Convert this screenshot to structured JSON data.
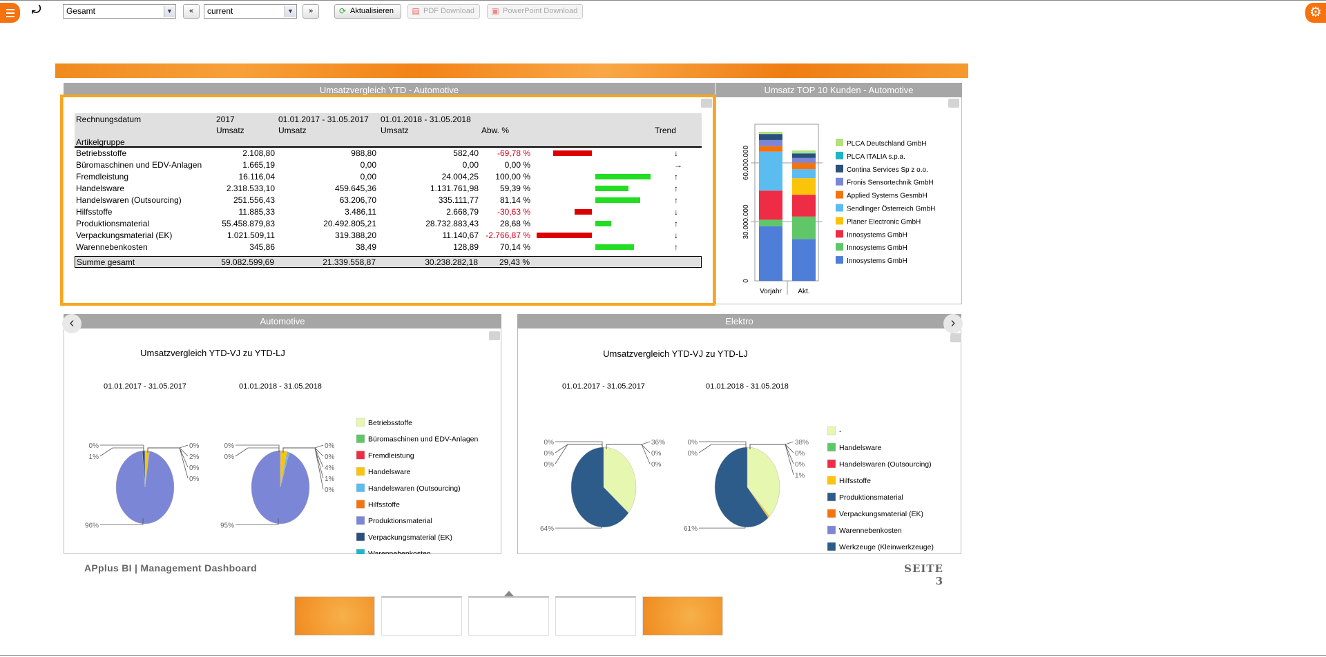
{
  "toolbar": {
    "menu_icon": "hamburger-icon",
    "return_icon": "return-arrow-icon",
    "scope_select": "Gesamt",
    "prev_label": "«",
    "period_select": "current",
    "next_label": "»",
    "refresh_label": "Aktualisieren",
    "pdf_label": "PDF Download",
    "ppt_label": "PowerPoint Download",
    "settings_icon": "gear-icon"
  },
  "colors": {
    "accent": "#f5730f",
    "highlight": "#f5a623",
    "header_gray": "#a6a6a6",
    "negative": "#d0021b",
    "positive_bar": "#22dd22",
    "negative_bar": "#dd0000"
  },
  "table_panel": {
    "title": "Umsatzvergleich YTD - Automotive",
    "header": {
      "rechnungsdatum": "Rechnungsdatum",
      "artikelgruppe": "Artikelgruppe",
      "col1_period": "2017",
      "col2_period": "01.01.2017 - 31.05.2017",
      "col3_period": "01.01.2018 - 31.05.2018",
      "umsatz": "Umsatz",
      "abw": "Abw. %",
      "trend": "Trend"
    },
    "rows": [
      {
        "name": "Betriebsstoffe",
        "c1": "2.108,80",
        "c2": "988,80",
        "c3": "582,40",
        "abw": "-69,78 %",
        "pct": -69.78,
        "trend": "↓"
      },
      {
        "name": "Büromaschinen und EDV-Anlagen",
        "c1": "1.665,19",
        "c2": "0,00",
        "c3": "0,00",
        "abw": "0,00 %",
        "pct": 0,
        "trend": "→"
      },
      {
        "name": "Fremdleistung",
        "c1": "16.116,04",
        "c2": "0,00",
        "c3": "24.004,25",
        "abw": "100,00 %",
        "pct": 100,
        "trend": "↑"
      },
      {
        "name": "Handelsware",
        "c1": "2.318.533,10",
        "c2": "459.645,36",
        "c3": "1.131.761,98",
        "abw": "59,39 %",
        "pct": 59.39,
        "trend": "↑"
      },
      {
        "name": "Handelswaren (Outsourcing)",
        "c1": "251.556,43",
        "c2": "63.206,70",
        "c3": "335.111,77",
        "abw": "81,14 %",
        "pct": 81.14,
        "trend": "↑"
      },
      {
        "name": "Hilfsstoffe",
        "c1": "11.885,33",
        "c2": "3.486,11",
        "c3": "2.668,79",
        "abw": "-30,63 %",
        "pct": -30.63,
        "trend": "↓"
      },
      {
        "name": "Produktionsmaterial",
        "c1": "55.458.879,83",
        "c2": "20.492.805,21",
        "c3": "28.732.883,43",
        "abw": "28,68 %",
        "pct": 28.68,
        "trend": "↑"
      },
      {
        "name": "Verpackungsmaterial (EK)",
        "c1": "1.021.509,11",
        "c2": "319.388,20",
        "c3": "11.140,67",
        "abw": "-2.766,87 %",
        "pct": -2766.87,
        "trend": "↓"
      },
      {
        "name": "Warennebenkosten",
        "c1": "345,86",
        "c2": "38,49",
        "c3": "128,89",
        "abw": "70,14 %",
        "pct": 70.14,
        "trend": "↑"
      }
    ],
    "total": {
      "name": "Summe gesamt",
      "c1": "59.082.599,69",
      "c2": "21.339.558,87",
      "c3": "30.238.282,18",
      "abw": "29,43 %"
    }
  },
  "top10_panel": {
    "title": "Umsatz TOP 10 Kunden - Automotive"
  },
  "automotive_panel": {
    "title": "Automotive",
    "chart_title": "Umsatzvergleich YTD-VJ zu YTD-LJ"
  },
  "elektro_panel": {
    "title": "Elektro",
    "chart_title": "Umsatzvergleich YTD-VJ zu YTD-LJ"
  },
  "chart_data": [
    {
      "type": "bar",
      "stacked": true,
      "categories": [
        "Vorjahr",
        "Akt."
      ],
      "ylim": [
        0,
        80000000
      ],
      "yticks": [
        "0",
        "30.000.000",
        "60.000.000"
      ],
      "ytick_values": [
        0,
        30000000,
        60000000
      ],
      "legend_placement": "right",
      "series": [
        {
          "name": "Innosystems GmbH",
          "color": "#4f7ed8",
          "values": [
            27800000,
            21300000
          ]
        },
        {
          "name": "Innosystems GmbH",
          "color": "#5fc767",
          "values": [
            3300000,
            11400000
          ]
        },
        {
          "name": "Innosystems GmbH",
          "color": "#ef2c45",
          "values": [
            14800000,
            11100000
          ]
        },
        {
          "name": "Planer Electronic GmbH",
          "color": "#fcc30b",
          "values": [
            0,
            8400000
          ]
        },
        {
          "name": "Sendlinger Österreich GmbH",
          "color": "#5bbcf0",
          "values": [
            19800000,
            4600000
          ]
        },
        {
          "name": "Applied Systems GesmbH",
          "color": "#f5730f",
          "values": [
            2800000,
            3300000
          ]
        },
        {
          "name": "Fronis Sensortechnik GmbH",
          "color": "#7b86d6",
          "values": [
            3100000,
            2400000
          ]
        },
        {
          "name": "Contina Services Sp z o.o.",
          "color": "#2d4f7c",
          "values": [
            3000000,
            2200000
          ]
        },
        {
          "name": "PLCA ITALIA s.p.a.",
          "color": "#1fb5c9",
          "values": [
            200000,
            300000
          ]
        },
        {
          "name": "PLCA Deutschland GmbH",
          "color": "#b5e07a",
          "values": [
            1000000,
            1300000
          ]
        }
      ]
    },
    {
      "type": "pie",
      "panel": "automotive",
      "categories": [
        "Betriebsstoffe",
        "Büromaschinen und EDV-Anlagen",
        "Fremdleistung",
        "Handelsware",
        "Handelswaren (Outsourcing)",
        "Hilfsstoffe",
        "Produktionsmaterial",
        "Verpackungsmaterial (EK)",
        "Warennebenkosten"
      ],
      "colors": [
        "#e6f7b0",
        "#5fc767",
        "#ef2c45",
        "#fcc30b",
        "#5bbcf0",
        "#f5730f",
        "#7b86d6",
        "#2d4f7c",
        "#1fb5c9"
      ],
      "pies": [
        {
          "title": "01.01.2017 - 31.05.2017",
          "values": [
            0.005,
            0,
            0,
            2.15,
            0.3,
            0.02,
            96.03,
            1.5,
            0.0002
          ],
          "labels_left": [
            "0%",
            "1%",
            "96%"
          ],
          "labels_right": [
            "0%",
            "2%",
            "0%",
            "0%"
          ]
        },
        {
          "title": "01.01.2018 - 31.05.2018",
          "values": [
            0.002,
            0,
            0.08,
            3.74,
            1.11,
            0.01,
            95.02,
            0.04,
            0.0004
          ],
          "labels_left": [
            "0%",
            "0%",
            "95%"
          ],
          "labels_right": [
            "0%",
            "0%",
            "4%",
            "1%",
            "0%"
          ]
        }
      ]
    },
    {
      "type": "pie",
      "panel": "elektro",
      "categories": [
        "-",
        "Handelsware",
        "Handelswaren (Outsourcing)",
        "Hilfsstoffe",
        "Produktionsmaterial",
        "Verpackungsmaterial (EK)",
        "Warennebenkosten",
        "Werkzeuge (Kleinwerkzeuge)"
      ],
      "colors": [
        "#e6f7b0",
        "#5fc767",
        "#ef2c45",
        "#fcc30b",
        "#2d5b8a",
        "#f5730f",
        "#7b86d6",
        "#2d5b8a"
      ],
      "pies": [
        {
          "title": "01.01.2017 - 31.05.2017",
          "values": [
            36,
            0,
            0,
            0.1,
            63.9,
            0,
            0,
            0
          ],
          "labels_left": [
            "0%",
            "0%",
            "0%",
            "64%"
          ],
          "labels_right": [
            "36%",
            "0%",
            "0%"
          ]
        },
        {
          "title": "01.01.2018 - 31.05.2018",
          "values": [
            38,
            0,
            0,
            0.8,
            61.2,
            0,
            0,
            0
          ],
          "labels_left": [
            "0%",
            "0%",
            "61%"
          ],
          "labels_right": [
            "38%",
            "0%",
            "0%",
            "1%"
          ]
        }
      ]
    }
  ],
  "footer": {
    "left": "APplus BI | Management Dashboard",
    "right": "SEITE 3"
  },
  "thumbnails": {
    "count": 5,
    "selected": 3
  }
}
